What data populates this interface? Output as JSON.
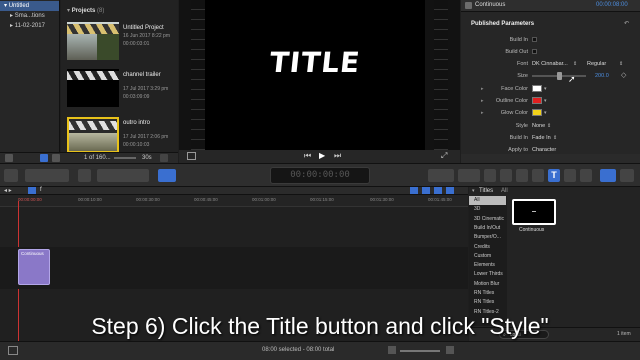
{
  "libraries": {
    "items": [
      {
        "label": "Untitled",
        "selected": true
      },
      {
        "label": "Sma...tions",
        "selected": false
      },
      {
        "label": "11-02-2017",
        "selected": false
      }
    ]
  },
  "browser": {
    "section_title": "Projects",
    "section_count": "(8)",
    "clips": [
      {
        "name": "Untitled Project",
        "date": "16 Jun 2017 8:22 pm",
        "duration": "00:00:03:01"
      },
      {
        "name": "channel trailer",
        "date": "17 Jul 2017 3:29 pm",
        "duration": "00:03:09:09"
      },
      {
        "name": "outro intro",
        "date": "17 Jul 2017 2:06 pm",
        "duration": "00:00:10:03"
      }
    ],
    "footer_count": "1 of 160...",
    "footer_zoom": "30s"
  },
  "viewer": {
    "title_text": "TITLE"
  },
  "inspector": {
    "title_name": "Continuous",
    "timecode": "00:00:08:00",
    "section": "Published Parameters",
    "params": [
      {
        "label": "Build In",
        "value": ""
      },
      {
        "label": "Build Out",
        "value": ""
      },
      {
        "label": "Font",
        "value": "DK Cinnabar...",
        "value2": "Regular"
      },
      {
        "label": "Size",
        "value": "",
        "value2": "200.0"
      },
      {
        "label": "Face Color",
        "value": ""
      },
      {
        "label": "Outline Color",
        "value": ""
      },
      {
        "label": "Glow Color",
        "value": ""
      },
      {
        "label": "Style",
        "value": "None"
      },
      {
        "label": "Build In",
        "value": "Fade In"
      },
      {
        "label": "Apply to",
        "value": "Character"
      }
    ],
    "face_color": "#ffffff",
    "outline_color": "#e02020",
    "glow_color": "#f2d21a",
    "size_fraction": 0.5
  },
  "toolbar": {
    "timecode": "00:00:00:00",
    "index_label": "f"
  },
  "timeline": {
    "ruler": [
      "00:00:00:00",
      "00:00:10:00",
      "00:00:30:00",
      "00:00:45:00",
      "00:01:00:00",
      "00:01:15:00",
      "00:01:30:00",
      "00:01:45:00"
    ],
    "clip_label": "Continuous"
  },
  "titles_browser": {
    "header": "Titles",
    "header_suffix": "All",
    "categories": [
      "All",
      "3D",
      "3D Cinematic",
      "Build In/Out",
      "Bumper/O...",
      "Credits",
      "Custom",
      "Elements",
      "Lower Thirds",
      "Motion Blur",
      "RN Titles",
      "RN Titles",
      "RN Titles-2"
    ],
    "selected_category": "All",
    "thumbnail_label": "Continuous",
    "search_placeholder": "conti",
    "item_count": "1 item"
  },
  "statusbar": {
    "text": "08:00 selected - 08:00 total"
  },
  "caption": "Step 6)  Click the Title button and click \"Style\""
}
